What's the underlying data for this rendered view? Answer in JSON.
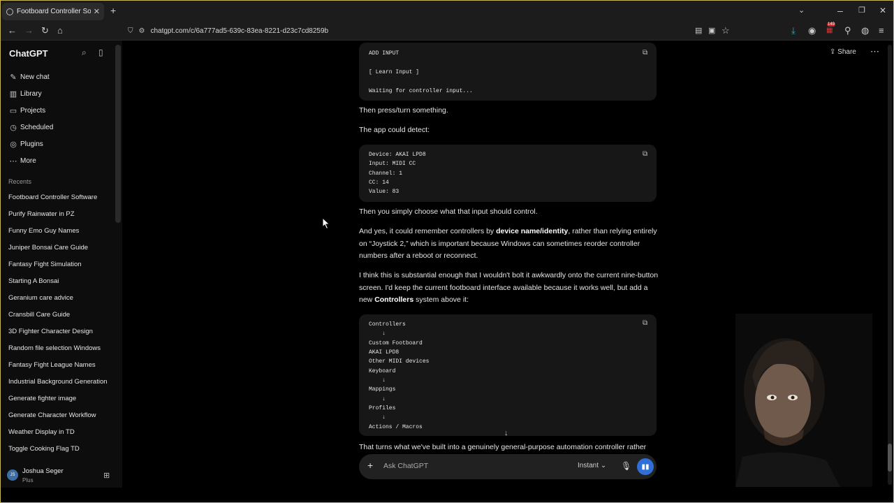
{
  "browser": {
    "tab_title": "Footboard Controller Software",
    "url": "chatgpt.com/c/6a777ad5-639c-83ea-8221-d23c7cd8259b",
    "badge_count": "149"
  },
  "sidebar": {
    "brand": "ChatGPT",
    "nav": [
      {
        "label": "New chat",
        "icon": "edit-icon"
      },
      {
        "label": "Library",
        "icon": "library-icon"
      },
      {
        "label": "Projects",
        "icon": "folder-icon"
      },
      {
        "label": "Scheduled",
        "icon": "clock-icon"
      },
      {
        "label": "Plugins",
        "icon": "plugin-icon"
      },
      {
        "label": "More",
        "icon": "dots-icon"
      }
    ],
    "recents_heading": "Recents",
    "recents": [
      "Footboard Controller Software",
      "Purify Rainwater in PZ",
      "Funny Emo Guy Names",
      "Juniper Bonsai Care Guide",
      "Fantasy Fight Simulation",
      "Starting A Bonsai",
      "Geranium care advice",
      "Cransbill Care Guide",
      "3D Fighter Character Design",
      "Random file selection Windows",
      "Fantasy Fight League Names",
      "Industrial Background Generation",
      "Generate fighter image",
      "Generate Character Workflow",
      "Weather Display in TD",
      "Toggle Cooking Flag TD"
    ],
    "user": {
      "initials": "JS",
      "name": "Joshua Seger",
      "plan": "Plus"
    }
  },
  "header": {
    "share_label": "Share"
  },
  "chat": {
    "code1": [
      "ADD INPUT",
      "",
      "[ Learn Input ]",
      "",
      "Waiting for controller input..."
    ],
    "p1": "Then press/turn something.",
    "p2": "The app could detect:",
    "code2": [
      "Device: AKAI LPD8",
      "Input: MIDI CC",
      "Channel: 1",
      "CC: 14",
      "Value: 83"
    ],
    "p3": "Then you simply choose what that input should control.",
    "p4": {
      "a": "And yes, it could remember controllers by ",
      "b": "device name/identity",
      "c": ", rather than relying entirely on “Joystick 2,” which is important because Windows can sometimes reorder controller numbers after a reboot or reconnect."
    },
    "p5": {
      "a": "I think this is substantial enough that I wouldn't bolt it awkwardly onto the current nine-button screen. I'd keep the current footboard interface available because it works well, but add a new ",
      "b": "Controllers",
      "c": " system above it:"
    },
    "code3": [
      "Controllers",
      "    ↓",
      "Custom Footboard",
      "AKAI LPD8",
      "Other MIDI devices",
      "Keyboard",
      "    ↓",
      "Mappings",
      "    ↓",
      "Profiles",
      "    ↓",
      "Actions / Macros"
    ],
    "p6": "That turns what we've built into a genuinely general-purpose automation controller rather"
  },
  "composer": {
    "placeholder": "Ask ChatGPT",
    "model": "Instant"
  }
}
